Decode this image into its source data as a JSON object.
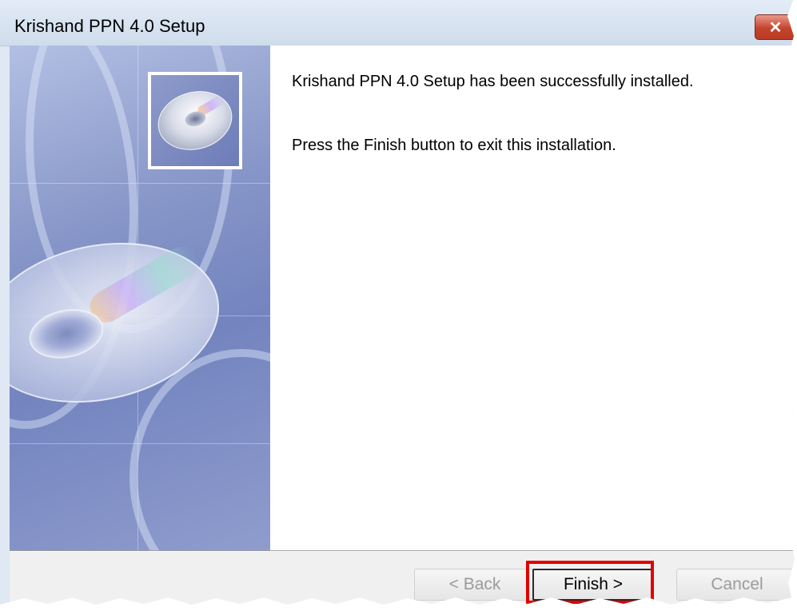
{
  "window": {
    "title": "Krishand PPN 4.0 Setup",
    "close_label": "✕"
  },
  "content": {
    "line1": "Krishand PPN 4.0 Setup has been successfully installed.",
    "line2": "Press the Finish button to exit this installation."
  },
  "buttons": {
    "back": "< Back",
    "finish": "Finish >",
    "cancel": "Cancel"
  },
  "icons": {
    "banner": "cd-disc-banner",
    "small": "cd-disc-icon"
  },
  "colors": {
    "highlight": "#e00000",
    "close": "#c5432e",
    "banner": "#7384bf"
  }
}
